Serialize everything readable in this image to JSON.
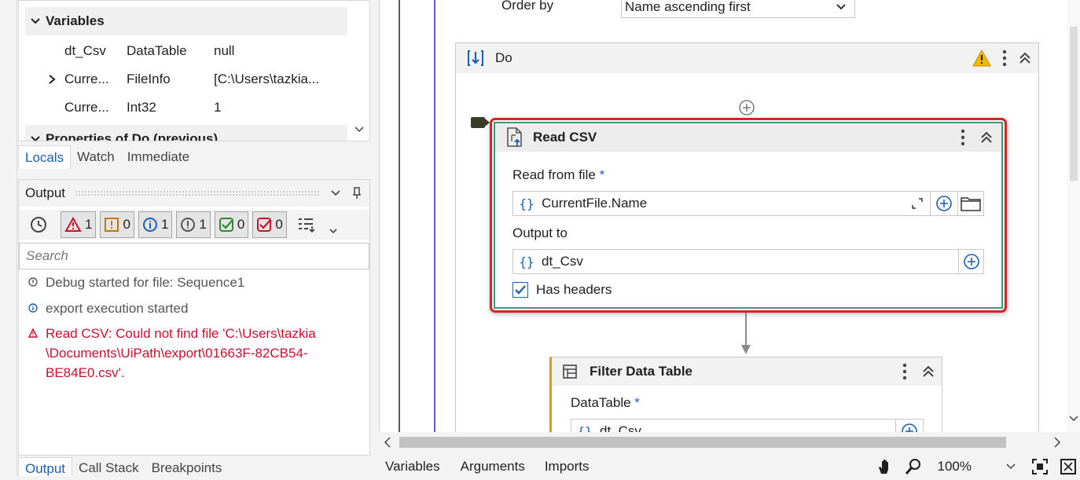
{
  "variables_panel": {
    "variables_title": "Variables",
    "rows": [
      {
        "name": "dt_Csv",
        "type": "DataTable",
        "value": "null"
      },
      {
        "name": "Curre...",
        "type": "FileInfo",
        "value": "[C:\\Users\\tazkia..."
      },
      {
        "name": "Curre...",
        "type": "Int32",
        "value": "1"
      }
    ],
    "properties_title": "Properties of Do (previous)"
  },
  "debug_tabs": [
    "Locals",
    "Watch",
    "Immediate"
  ],
  "output_panel": {
    "title": "Output",
    "filters": [
      {
        "icon": "error-icon",
        "count": "1",
        "color": "#c8102e"
      },
      {
        "icon": "warning-icon",
        "count": "0",
        "color": "#c87400"
      },
      {
        "icon": "info-icon",
        "count": "1",
        "color": "#1a5fb4"
      },
      {
        "icon": "trace-icon",
        "count": "1",
        "color": "#555555"
      },
      {
        "icon": "success-icon",
        "count": "0",
        "color": "#2e8b2e"
      },
      {
        "icon": "fail-icon",
        "count": "0",
        "color": "#c8102e"
      }
    ],
    "search_placeholder": "Search",
    "log": [
      {
        "level": "trace",
        "text": "Debug started for file: Sequence1"
      },
      {
        "level": "info",
        "text": "export execution started"
      },
      {
        "level": "error",
        "line1": "Read CSV: Could not find file 'C:\\Users\\tazkia",
        "line2": "\\Documents\\UiPath\\export\\01663F-82CB54-",
        "line3": "BE84E0.csv'."
      }
    ]
  },
  "bottom_tabs_left": [
    "Output",
    "Call Stack",
    "Breakpoints"
  ],
  "designer": {
    "order_by_label": "Order by",
    "order_by_value": "Name ascending first",
    "do_title": "Do",
    "read_csv": {
      "title": "Read CSV",
      "read_from_label": "Read from file",
      "read_from_value": "CurrentFile.Name",
      "output_label": "Output to",
      "output_value": "dt_Csv",
      "has_headers_label": "Has headers",
      "has_headers_checked": true
    },
    "filter_data_table": {
      "title": "Filter Data Table",
      "datatable_label": "DataTable",
      "datatable_value": "dt_Csv"
    }
  },
  "bottom_tabs_right": [
    "Variables",
    "Arguments",
    "Imports"
  ],
  "zoom": "100%",
  "colors": {
    "accent": "#1a5fb4",
    "error": "#c8102e",
    "selection_border": "#e02020",
    "purple": "#6a5acd"
  }
}
